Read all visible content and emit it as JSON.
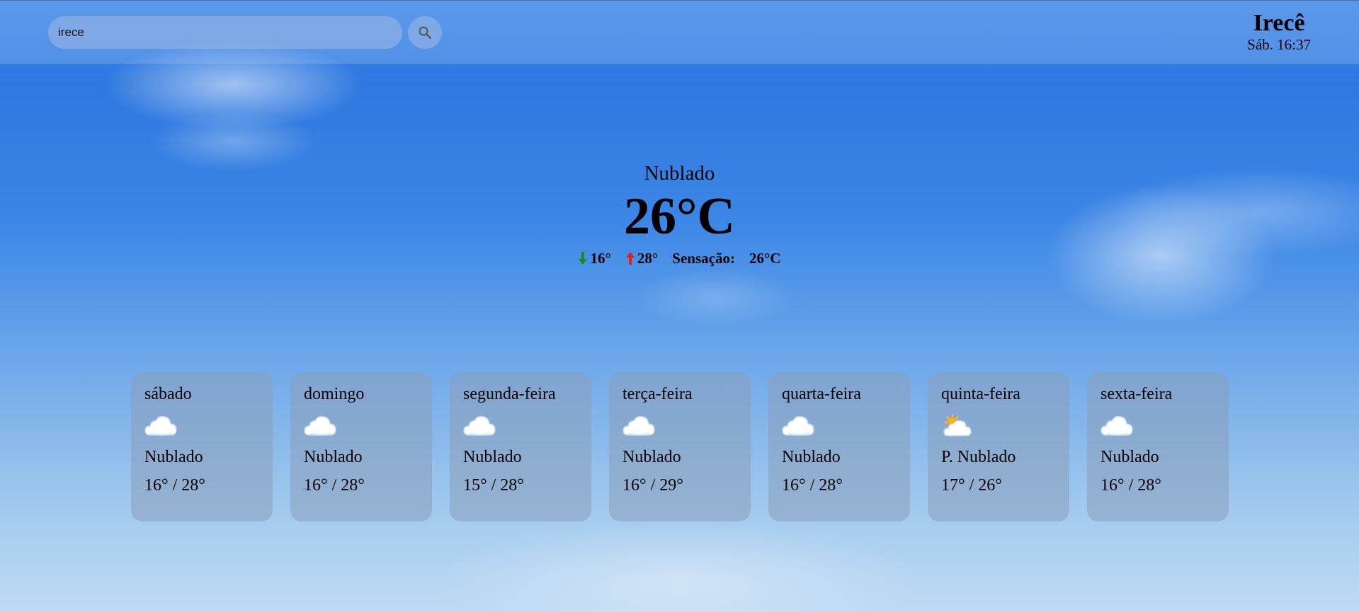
{
  "search": {
    "value": "irece",
    "icon": "search-icon"
  },
  "location": {
    "city": "Irecê",
    "datetime": "Sáb. 16:37"
  },
  "current": {
    "condition": "Nublado",
    "temperature": "26°C",
    "min": "16°",
    "max": "28°",
    "feels_label": "Sensação:",
    "feels_value": "26°C"
  },
  "colors": {
    "down_arrow": "#1a8c1a",
    "up_arrow": "#e02020"
  },
  "forecast": [
    {
      "day": "sábado",
      "icon": "cloud-icon",
      "condition": "Nublado",
      "range": "16° / 28°"
    },
    {
      "day": "domingo",
      "icon": "cloud-icon",
      "condition": "Nublado",
      "range": "16° / 28°"
    },
    {
      "day": "segunda-feira",
      "icon": "cloud-icon",
      "condition": "Nublado",
      "range": "15° / 28°"
    },
    {
      "day": "terça-feira",
      "icon": "cloud-icon",
      "condition": "Nublado",
      "range": "16° / 29°"
    },
    {
      "day": "quarta-feira",
      "icon": "cloud-icon",
      "condition": "Nublado",
      "range": "16° / 28°"
    },
    {
      "day": "quinta-feira",
      "icon": "sun-behind-cloud-icon",
      "condition": "P. Nublado",
      "range": "17° / 26°"
    },
    {
      "day": "sexta-feira",
      "icon": "cloud-icon",
      "condition": "Nublado",
      "range": "16° / 28°"
    }
  ]
}
